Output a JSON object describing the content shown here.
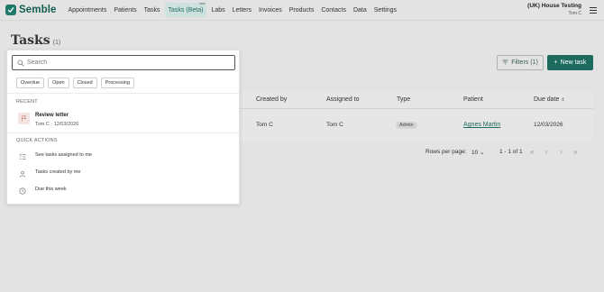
{
  "brand": {
    "name": "Semble"
  },
  "nav": {
    "items": [
      "Appointments",
      "Patients",
      "Tasks",
      "Tasks (Beta)",
      "Labs",
      "Letters",
      "Invoices",
      "Products",
      "Contacts",
      "Data",
      "Settings"
    ],
    "active_index": 3,
    "beta_badge": "new"
  },
  "org": {
    "name": "(UK) House Testing",
    "user": "Tom C"
  },
  "page": {
    "title": "Tasks",
    "count": "(1)"
  },
  "toolbar": {
    "filters_label": "Filters (1)",
    "new_task_label": "New task"
  },
  "table": {
    "headers": {
      "created_by": "Created by",
      "assigned_to": "Assigned to",
      "type": "Type",
      "patient": "Patient",
      "due_date": "Due date"
    },
    "row": {
      "created_by": "Tom C",
      "assigned_to": "Tom C",
      "type": "Admin",
      "patient": "Agnes Martin",
      "due_date": "12/03/2026"
    }
  },
  "pagination": {
    "rows_per_page_label": "Rows per page:",
    "rows_per_page_value": "10",
    "range": "1 - 1 of 1"
  },
  "search": {
    "placeholder": "Search",
    "chips": [
      "Overdue",
      "Open",
      "Closed",
      "Processing"
    ],
    "recent_label": "RECENT",
    "recent_items": [
      {
        "title": "Review letter",
        "subtitle": "Tom C · 12/03/2026"
      }
    ],
    "quick_actions_label": "QUICK ACTIONS",
    "quick_actions": [
      {
        "label": "See tasks assigned to me",
        "icon": "list-check-icon"
      },
      {
        "label": "Tasks created by me",
        "icon": "user-icon"
      },
      {
        "label": "Due this week",
        "icon": "clock-icon"
      }
    ]
  },
  "colors": {
    "brand": "#1d6b5e",
    "background": "#e3e3e3",
    "active_tab": "#cfe1df"
  }
}
